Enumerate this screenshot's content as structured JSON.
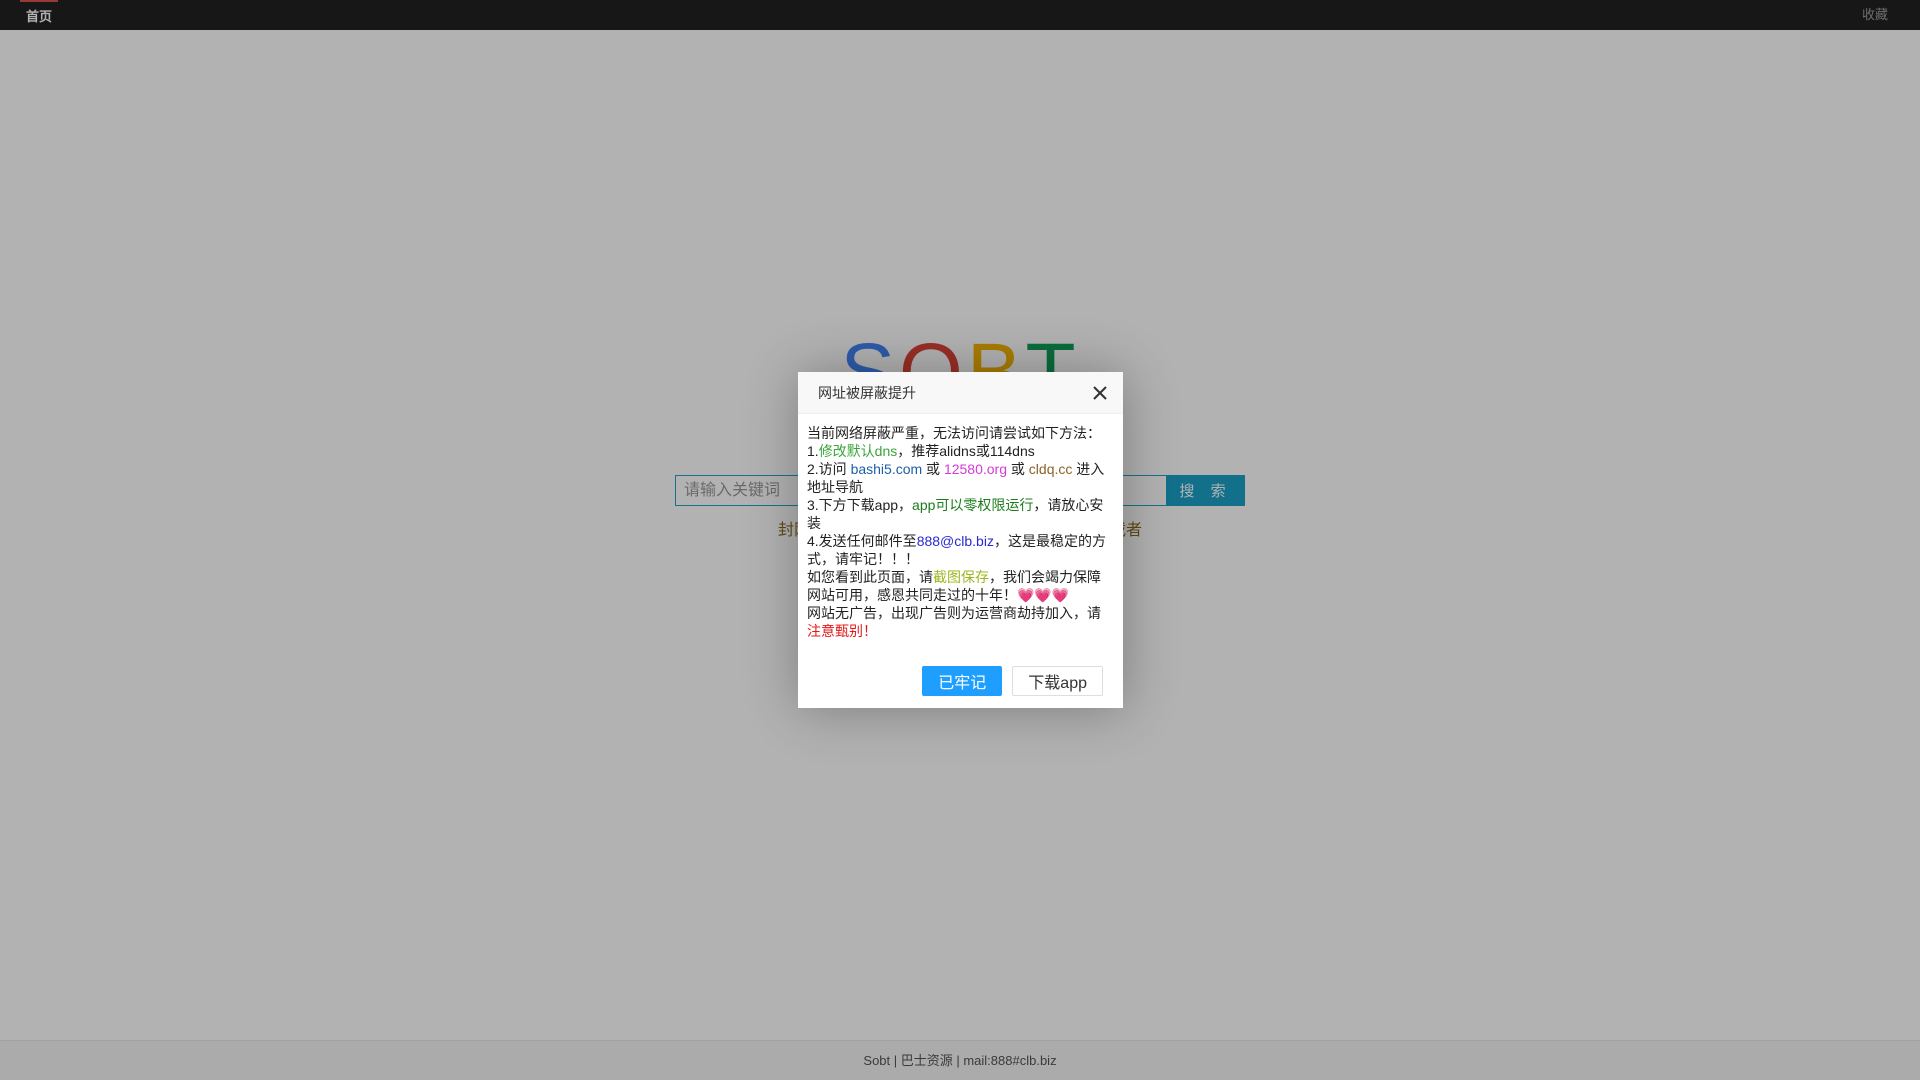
{
  "nav": {
    "home_label": "首页",
    "favorite_label": "收藏"
  },
  "logo": {
    "letters": [
      "S",
      "O",
      "B",
      "T"
    ],
    "colors": [
      "#4285f4",
      "#db4437",
      "#f4b400",
      "#0f9d58"
    ]
  },
  "search": {
    "placeholder": "请输入关键词",
    "button_label": "搜 索"
  },
  "notice": {
    "left_text": "封网",
    "right_text": "载者"
  },
  "footer": {
    "text": "Sobt | 巴士资源 | mail:888#clb.biz"
  },
  "dialog": {
    "title": "网址被屏蔽提升",
    "intro": "当前网络屏蔽严重，无法访问请尝试如下方法：",
    "line1_prefix": "1.",
    "line1_link": "修改默认dns",
    "line1_suffix": "，推荐alidns或114dns",
    "line2_prefix": "2.访问 ",
    "line2_link1": "bashi5.com",
    "line2_or1": " 或 ",
    "line2_link2": "12580.org",
    "line2_or2": " 或 ",
    "line2_link3": "cldq.cc",
    "line2_suffix": " 进入地址导航",
    "line3_prefix": "3.下方下载app，",
    "line3_highlight": "app可以零权限运行",
    "line3_suffix": "，请放心安装",
    "line4_prefix": "4.发送任何邮件至",
    "line4_email": "888@clb.biz",
    "line4_suffix": "，这是最稳定的方式，请牢记！！！",
    "line5_prefix": "如您看到此页面，请",
    "line5_highlight": "截图保存",
    "line5_suffix": "，我们会竭力保障网站可用，感恩共同走过的十年！",
    "line5_hearts": "💗💗💗",
    "line6_prefix": "网站无广告，出现广告则为运营商劫持加入，请",
    "line6_highlight": "注意甄别！",
    "confirm_label": "已牢记",
    "download_label": "下载app"
  }
}
